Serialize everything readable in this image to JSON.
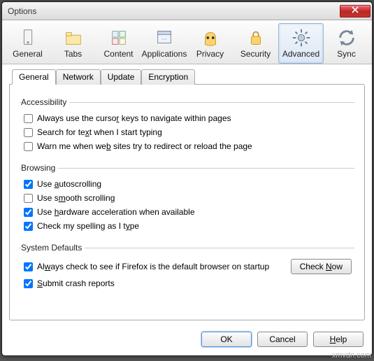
{
  "window": {
    "title": "Options"
  },
  "toolbar": {
    "items": [
      {
        "label": "General"
      },
      {
        "label": "Tabs"
      },
      {
        "label": "Content"
      },
      {
        "label": "Applications"
      },
      {
        "label": "Privacy"
      },
      {
        "label": "Security"
      },
      {
        "label": "Advanced"
      },
      {
        "label": "Sync"
      }
    ],
    "selected": "Advanced"
  },
  "subtabs": {
    "items": [
      "General",
      "Network",
      "Update",
      "Encryption"
    ],
    "active": "General"
  },
  "groups": {
    "accessibility": {
      "legend": "Accessibility",
      "items": [
        {
          "label": "Always use the cursor keys to navigate within pages",
          "checked": false,
          "accel_index": 20
        },
        {
          "label": "Search for text when I start typing",
          "checked": false,
          "accel_index": 13
        },
        {
          "label": "Warn me when web sites try to redirect or reload the page",
          "checked": false,
          "accel_index": 15
        }
      ]
    },
    "browsing": {
      "legend": "Browsing",
      "items": [
        {
          "label": "Use autoscrolling",
          "checked": true,
          "accel_index": 4
        },
        {
          "label": "Use smooth scrolling",
          "checked": false,
          "accel_index": 5
        },
        {
          "label": "Use hardware acceleration when available",
          "checked": true,
          "accel_index": 4
        },
        {
          "label": "Check my spelling as I type",
          "checked": true,
          "accel_index": 24
        }
      ]
    },
    "defaults": {
      "legend": "System Defaults",
      "items": [
        {
          "label": "Always check to see if Firefox is the default browser on startup",
          "checked": true,
          "accel_index": 2
        },
        {
          "label": "Submit crash reports",
          "checked": true,
          "accel_index": 0
        }
      ],
      "check_now": "Check Now",
      "check_now_accel": 6
    }
  },
  "footer": {
    "ok": "OK",
    "cancel": "Cancel",
    "help": "Help"
  },
  "watermark": "xmvdn.com"
}
